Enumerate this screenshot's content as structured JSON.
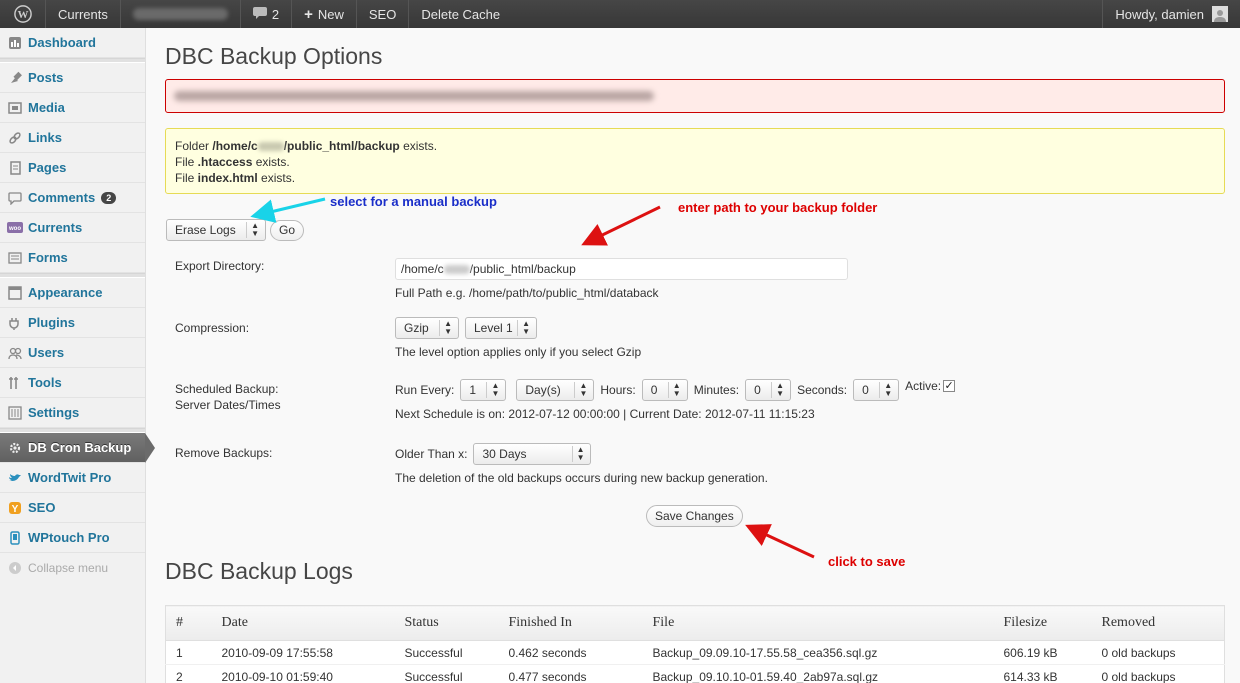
{
  "adminbar": {
    "site_name": "Currents",
    "comments_count": "2",
    "new_label": "New",
    "seo_label": "SEO",
    "delete_cache_label": "Delete Cache",
    "howdy": "Howdy, damien"
  },
  "sidebar": {
    "items": [
      {
        "label": "Dashboard"
      },
      {
        "label": "Posts"
      },
      {
        "label": "Media"
      },
      {
        "label": "Links"
      },
      {
        "label": "Pages"
      },
      {
        "label": "Comments",
        "badge": "2"
      },
      {
        "label": "Currents"
      },
      {
        "label": "Forms"
      },
      {
        "label": "Appearance"
      },
      {
        "label": "Plugins"
      },
      {
        "label": "Users"
      },
      {
        "label": "Tools"
      },
      {
        "label": "Settings"
      },
      {
        "label": "DB Cron Backup"
      },
      {
        "label": "WordTwit Pro"
      },
      {
        "label": "SEO"
      },
      {
        "label": "WPtouch Pro"
      }
    ],
    "collapse_label": "Collapse menu"
  },
  "page": {
    "title": "DBC Backup Options",
    "notice": {
      "line1_prefix": "Folder ",
      "line1_path_a": "/home/c",
      "line1_path_b": "/public_html/backup",
      "line1_suffix": " exists.",
      "line2_prefix": "File ",
      "line2_file": ".htaccess",
      "line2_suffix": " exists.",
      "line3_prefix": "File ",
      "line3_file": "index.html",
      "line3_suffix": " exists."
    },
    "bulk": {
      "selected": "Erase Logs",
      "go_label": "Go"
    },
    "form": {
      "export_label": "Export Directory:",
      "export_value_a": "/home/c",
      "export_value_b": "/public_html/backup",
      "export_desc": "Full Path e.g. /home/path/to/public_html/databack",
      "compression_label": "Compression:",
      "compression_value": "Gzip",
      "level_value": "Level 1",
      "compression_desc": "The level option applies only if you select Gzip",
      "schedule_label_1": "Scheduled Backup:",
      "schedule_label_2": "Server Dates/Times",
      "run_every_label": "Run Every:",
      "run_every_value": "1",
      "unit_value": "Day(s)",
      "hours_label": "Hours:",
      "hours_value": "0",
      "minutes_label": "Minutes:",
      "minutes_value": "0",
      "seconds_label": "Seconds:",
      "seconds_value": "0",
      "active_label": "Active:",
      "next_schedule": "Next Schedule is on: 2012-07-12 00:00:00 | Current Date: 2012-07-11 11:15:23",
      "remove_label": "Remove Backups:",
      "older_than_label": "Older Than x:",
      "older_than_value": "30 Days",
      "remove_desc": "The deletion of the old backups occurs during new backup generation.",
      "save_label": "Save Changes"
    },
    "annotations": {
      "manual": "select for a manual backup",
      "path": "enter path to your backup folder",
      "save": "click to save"
    },
    "logs": {
      "title": "DBC Backup Logs",
      "columns": [
        "#",
        "Date",
        "Status",
        "Finished In",
        "File",
        "Filesize",
        "Removed"
      ],
      "rows": [
        [
          "1",
          "2010-09-09 17:55:58",
          "Successful",
          "0.462 seconds",
          "Backup_09.09.10-17.55.58_cea356.sql.gz",
          "606.19 kB",
          "0 old backups"
        ],
        [
          "2",
          "2010-09-10 01:59:40",
          "Successful",
          "0.477 seconds",
          "Backup_09.10.10-01.59.40_2ab97a.sql.gz",
          "614.33 kB",
          "0 old backups"
        ]
      ]
    }
  },
  "colors": {
    "link": "#21759b",
    "annot_blue": "#1a2ec9",
    "annot_red": "#dd0000",
    "arrow_cyan": "#19d3e8",
    "arrow_red": "#dd1111"
  }
}
